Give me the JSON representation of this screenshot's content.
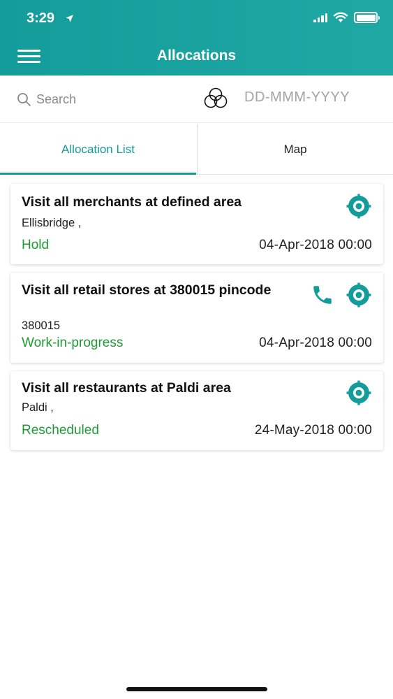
{
  "status_bar": {
    "time": "3:29"
  },
  "header": {
    "title": "Allocations"
  },
  "search": {
    "placeholder": "Search",
    "date_placeholder": "DD-MMM-YYYY"
  },
  "tabs": [
    {
      "label": "Allocation List",
      "active": true
    },
    {
      "label": "Map",
      "active": false
    }
  ],
  "allocations": [
    {
      "title": "Visit all merchants at defined area",
      "subtitle": "Ellisbridge ,",
      "status": "Hold",
      "datetime": "04-Apr-2018 00:00",
      "has_phone": false
    },
    {
      "title": "Visit all retail stores at 380015 pincode",
      "subtitle": "380015",
      "status": "Work-in-progress",
      "datetime": "04-Apr-2018 00:00",
      "has_phone": true
    },
    {
      "title": "Visit all restaurants at Paldi area",
      "subtitle": "Paldi ,",
      "status": "Rescheduled",
      "datetime": "24-May-2018 00:00",
      "has_phone": false
    }
  ],
  "colors": {
    "accent": "#159b98",
    "status_green": "#1f9a36"
  },
  "icons": [
    "menu-icon",
    "search-icon",
    "filter-icon",
    "target-icon",
    "phone-icon"
  ]
}
